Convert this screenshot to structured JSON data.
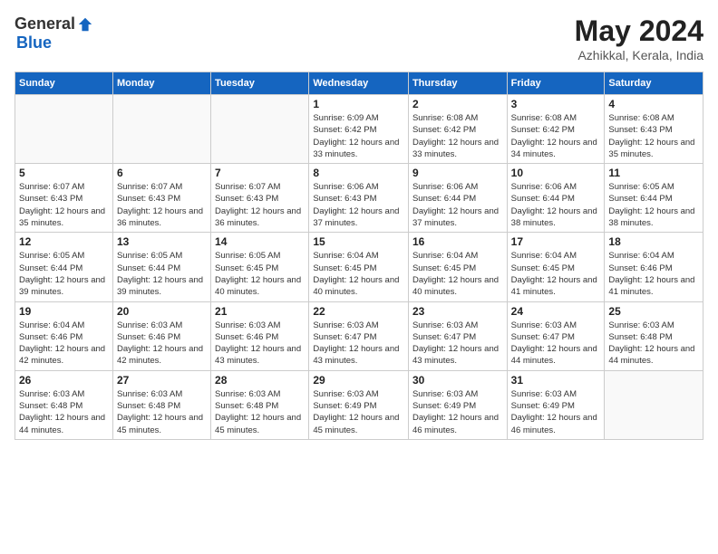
{
  "header": {
    "logo_general": "General",
    "logo_blue": "Blue",
    "month": "May 2024",
    "location": "Azhikkal, Kerala, India"
  },
  "weekdays": [
    "Sunday",
    "Monday",
    "Tuesday",
    "Wednesday",
    "Thursday",
    "Friday",
    "Saturday"
  ],
  "weeks": [
    [
      {
        "day": "",
        "info": ""
      },
      {
        "day": "",
        "info": ""
      },
      {
        "day": "",
        "info": ""
      },
      {
        "day": "1",
        "info": "Sunrise: 6:09 AM\nSunset: 6:42 PM\nDaylight: 12 hours\nand 33 minutes."
      },
      {
        "day": "2",
        "info": "Sunrise: 6:08 AM\nSunset: 6:42 PM\nDaylight: 12 hours\nand 33 minutes."
      },
      {
        "day": "3",
        "info": "Sunrise: 6:08 AM\nSunset: 6:42 PM\nDaylight: 12 hours\nand 34 minutes."
      },
      {
        "day": "4",
        "info": "Sunrise: 6:08 AM\nSunset: 6:43 PM\nDaylight: 12 hours\nand 35 minutes."
      }
    ],
    [
      {
        "day": "5",
        "info": "Sunrise: 6:07 AM\nSunset: 6:43 PM\nDaylight: 12 hours\nand 35 minutes."
      },
      {
        "day": "6",
        "info": "Sunrise: 6:07 AM\nSunset: 6:43 PM\nDaylight: 12 hours\nand 36 minutes."
      },
      {
        "day": "7",
        "info": "Sunrise: 6:07 AM\nSunset: 6:43 PM\nDaylight: 12 hours\nand 36 minutes."
      },
      {
        "day": "8",
        "info": "Sunrise: 6:06 AM\nSunset: 6:43 PM\nDaylight: 12 hours\nand 37 minutes."
      },
      {
        "day": "9",
        "info": "Sunrise: 6:06 AM\nSunset: 6:44 PM\nDaylight: 12 hours\nand 37 minutes."
      },
      {
        "day": "10",
        "info": "Sunrise: 6:06 AM\nSunset: 6:44 PM\nDaylight: 12 hours\nand 38 minutes."
      },
      {
        "day": "11",
        "info": "Sunrise: 6:05 AM\nSunset: 6:44 PM\nDaylight: 12 hours\nand 38 minutes."
      }
    ],
    [
      {
        "day": "12",
        "info": "Sunrise: 6:05 AM\nSunset: 6:44 PM\nDaylight: 12 hours\nand 39 minutes."
      },
      {
        "day": "13",
        "info": "Sunrise: 6:05 AM\nSunset: 6:44 PM\nDaylight: 12 hours\nand 39 minutes."
      },
      {
        "day": "14",
        "info": "Sunrise: 6:05 AM\nSunset: 6:45 PM\nDaylight: 12 hours\nand 40 minutes."
      },
      {
        "day": "15",
        "info": "Sunrise: 6:04 AM\nSunset: 6:45 PM\nDaylight: 12 hours\nand 40 minutes."
      },
      {
        "day": "16",
        "info": "Sunrise: 6:04 AM\nSunset: 6:45 PM\nDaylight: 12 hours\nand 40 minutes."
      },
      {
        "day": "17",
        "info": "Sunrise: 6:04 AM\nSunset: 6:45 PM\nDaylight: 12 hours\nand 41 minutes."
      },
      {
        "day": "18",
        "info": "Sunrise: 6:04 AM\nSunset: 6:46 PM\nDaylight: 12 hours\nand 41 minutes."
      }
    ],
    [
      {
        "day": "19",
        "info": "Sunrise: 6:04 AM\nSunset: 6:46 PM\nDaylight: 12 hours\nand 42 minutes."
      },
      {
        "day": "20",
        "info": "Sunrise: 6:03 AM\nSunset: 6:46 PM\nDaylight: 12 hours\nand 42 minutes."
      },
      {
        "day": "21",
        "info": "Sunrise: 6:03 AM\nSunset: 6:46 PM\nDaylight: 12 hours\nand 43 minutes."
      },
      {
        "day": "22",
        "info": "Sunrise: 6:03 AM\nSunset: 6:47 PM\nDaylight: 12 hours\nand 43 minutes."
      },
      {
        "day": "23",
        "info": "Sunrise: 6:03 AM\nSunset: 6:47 PM\nDaylight: 12 hours\nand 43 minutes."
      },
      {
        "day": "24",
        "info": "Sunrise: 6:03 AM\nSunset: 6:47 PM\nDaylight: 12 hours\nand 44 minutes."
      },
      {
        "day": "25",
        "info": "Sunrise: 6:03 AM\nSunset: 6:48 PM\nDaylight: 12 hours\nand 44 minutes."
      }
    ],
    [
      {
        "day": "26",
        "info": "Sunrise: 6:03 AM\nSunset: 6:48 PM\nDaylight: 12 hours\nand 44 minutes."
      },
      {
        "day": "27",
        "info": "Sunrise: 6:03 AM\nSunset: 6:48 PM\nDaylight: 12 hours\nand 45 minutes."
      },
      {
        "day": "28",
        "info": "Sunrise: 6:03 AM\nSunset: 6:48 PM\nDaylight: 12 hours\nand 45 minutes."
      },
      {
        "day": "29",
        "info": "Sunrise: 6:03 AM\nSunset: 6:49 PM\nDaylight: 12 hours\nand 45 minutes."
      },
      {
        "day": "30",
        "info": "Sunrise: 6:03 AM\nSunset: 6:49 PM\nDaylight: 12 hours\nand 46 minutes."
      },
      {
        "day": "31",
        "info": "Sunrise: 6:03 AM\nSunset: 6:49 PM\nDaylight: 12 hours\nand 46 minutes."
      },
      {
        "day": "",
        "info": ""
      }
    ]
  ]
}
